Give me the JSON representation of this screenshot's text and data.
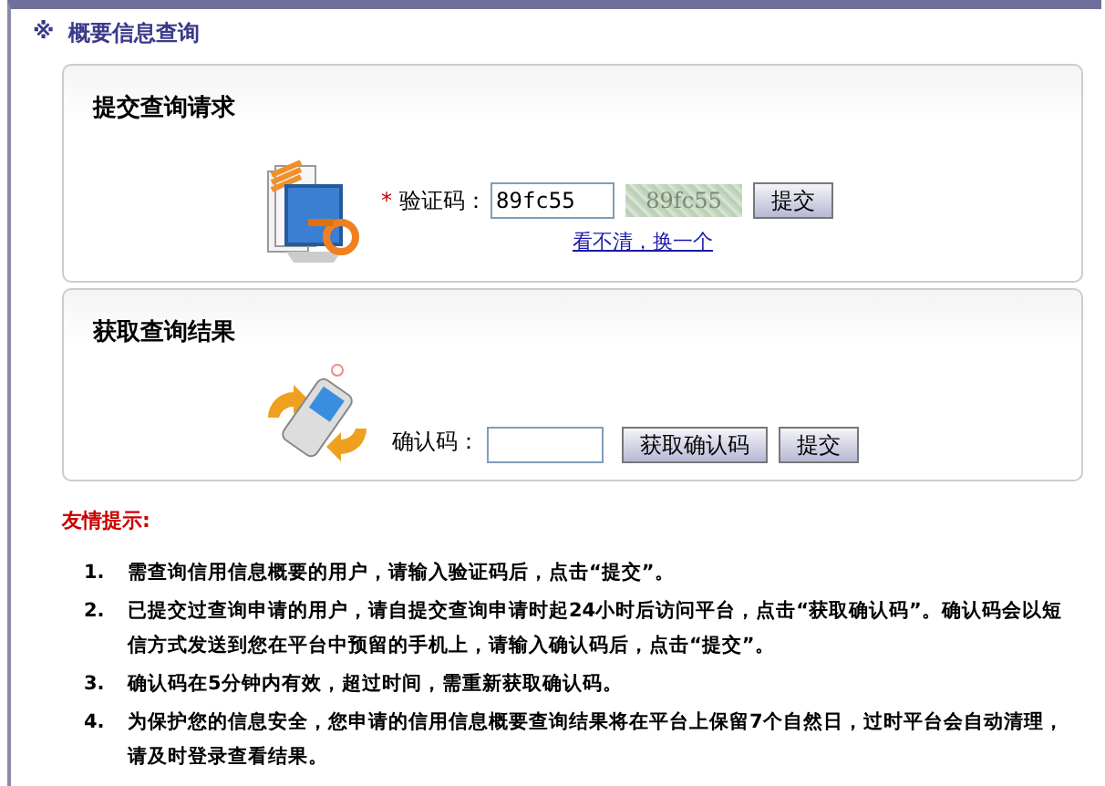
{
  "page_title": {
    "mark": "※",
    "text": "概要信息查询"
  },
  "submit_panel": {
    "heading": "提交查询请求",
    "required_mark": "*",
    "label": "验证码：",
    "value": "89fc55",
    "captcha_text": "89fc55",
    "submit_button": "提交",
    "refresh_link": "看不清，换一个"
  },
  "result_panel": {
    "heading": "获取查询结果",
    "label": "确认码：",
    "get_code_button": "获取确认码",
    "submit_button": "提交"
  },
  "tips": {
    "heading": "友情提示:",
    "items": [
      {
        "number": "1.",
        "text": "需查询信用信息概要的用户，请输入验证码后，点击“提交”。"
      },
      {
        "number": "2.",
        "text": "已提交过查询申请的用户，请自提交查询申请时起24小时后访问平台，点击“获取确认码”。确认码会以短信方式发送到您在平台中预留的手机上，请输入确认码后，点击“提交”。"
      },
      {
        "number": "3.",
        "text": "确认码在5分钟内有效，超过时间，需重新获取确认码。"
      },
      {
        "number": "4.",
        "text": "为保护您的信息安全，您申请的信用信息概要查询结果将在平台上保留7个自然日，过时平台会自动清理，请及时登录查看结果。"
      }
    ]
  }
}
